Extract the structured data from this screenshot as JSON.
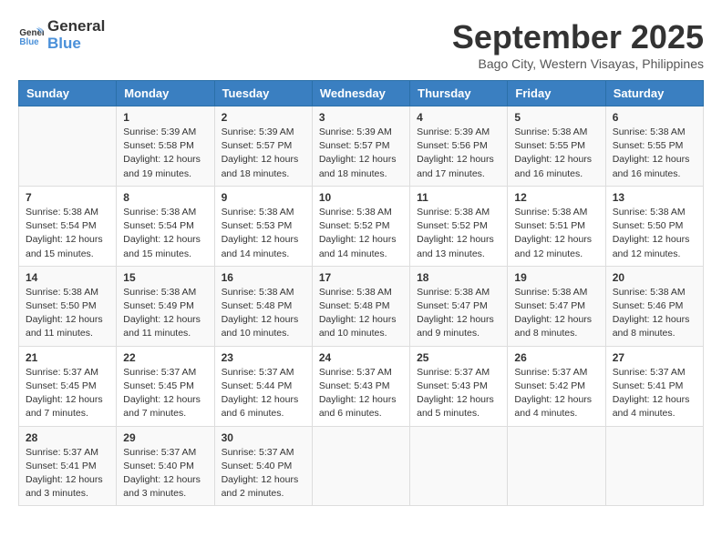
{
  "logo": {
    "text_general": "General",
    "text_blue": "Blue"
  },
  "title": {
    "month": "September 2025",
    "location": "Bago City, Western Visayas, Philippines"
  },
  "calendar": {
    "headers": [
      "Sunday",
      "Monday",
      "Tuesday",
      "Wednesday",
      "Thursday",
      "Friday",
      "Saturday"
    ],
    "weeks": [
      [
        {
          "day": "",
          "info": ""
        },
        {
          "day": "1",
          "info": "Sunrise: 5:39 AM\nSunset: 5:58 PM\nDaylight: 12 hours\nand 19 minutes."
        },
        {
          "day": "2",
          "info": "Sunrise: 5:39 AM\nSunset: 5:57 PM\nDaylight: 12 hours\nand 18 minutes."
        },
        {
          "day": "3",
          "info": "Sunrise: 5:39 AM\nSunset: 5:57 PM\nDaylight: 12 hours\nand 18 minutes."
        },
        {
          "day": "4",
          "info": "Sunrise: 5:39 AM\nSunset: 5:56 PM\nDaylight: 12 hours\nand 17 minutes."
        },
        {
          "day": "5",
          "info": "Sunrise: 5:38 AM\nSunset: 5:55 PM\nDaylight: 12 hours\nand 16 minutes."
        },
        {
          "day": "6",
          "info": "Sunrise: 5:38 AM\nSunset: 5:55 PM\nDaylight: 12 hours\nand 16 minutes."
        }
      ],
      [
        {
          "day": "7",
          "info": "Sunrise: 5:38 AM\nSunset: 5:54 PM\nDaylight: 12 hours\nand 15 minutes."
        },
        {
          "day": "8",
          "info": "Sunrise: 5:38 AM\nSunset: 5:54 PM\nDaylight: 12 hours\nand 15 minutes."
        },
        {
          "day": "9",
          "info": "Sunrise: 5:38 AM\nSunset: 5:53 PM\nDaylight: 12 hours\nand 14 minutes."
        },
        {
          "day": "10",
          "info": "Sunrise: 5:38 AM\nSunset: 5:52 PM\nDaylight: 12 hours\nand 14 minutes."
        },
        {
          "day": "11",
          "info": "Sunrise: 5:38 AM\nSunset: 5:52 PM\nDaylight: 12 hours\nand 13 minutes."
        },
        {
          "day": "12",
          "info": "Sunrise: 5:38 AM\nSunset: 5:51 PM\nDaylight: 12 hours\nand 12 minutes."
        },
        {
          "day": "13",
          "info": "Sunrise: 5:38 AM\nSunset: 5:50 PM\nDaylight: 12 hours\nand 12 minutes."
        }
      ],
      [
        {
          "day": "14",
          "info": "Sunrise: 5:38 AM\nSunset: 5:50 PM\nDaylight: 12 hours\nand 11 minutes."
        },
        {
          "day": "15",
          "info": "Sunrise: 5:38 AM\nSunset: 5:49 PM\nDaylight: 12 hours\nand 11 minutes."
        },
        {
          "day": "16",
          "info": "Sunrise: 5:38 AM\nSunset: 5:48 PM\nDaylight: 12 hours\nand 10 minutes."
        },
        {
          "day": "17",
          "info": "Sunrise: 5:38 AM\nSunset: 5:48 PM\nDaylight: 12 hours\nand 10 minutes."
        },
        {
          "day": "18",
          "info": "Sunrise: 5:38 AM\nSunset: 5:47 PM\nDaylight: 12 hours\nand 9 minutes."
        },
        {
          "day": "19",
          "info": "Sunrise: 5:38 AM\nSunset: 5:47 PM\nDaylight: 12 hours\nand 8 minutes."
        },
        {
          "day": "20",
          "info": "Sunrise: 5:38 AM\nSunset: 5:46 PM\nDaylight: 12 hours\nand 8 minutes."
        }
      ],
      [
        {
          "day": "21",
          "info": "Sunrise: 5:37 AM\nSunset: 5:45 PM\nDaylight: 12 hours\nand 7 minutes."
        },
        {
          "day": "22",
          "info": "Sunrise: 5:37 AM\nSunset: 5:45 PM\nDaylight: 12 hours\nand 7 minutes."
        },
        {
          "day": "23",
          "info": "Sunrise: 5:37 AM\nSunset: 5:44 PM\nDaylight: 12 hours\nand 6 minutes."
        },
        {
          "day": "24",
          "info": "Sunrise: 5:37 AM\nSunset: 5:43 PM\nDaylight: 12 hours\nand 6 minutes."
        },
        {
          "day": "25",
          "info": "Sunrise: 5:37 AM\nSunset: 5:43 PM\nDaylight: 12 hours\nand 5 minutes."
        },
        {
          "day": "26",
          "info": "Sunrise: 5:37 AM\nSunset: 5:42 PM\nDaylight: 12 hours\nand 4 minutes."
        },
        {
          "day": "27",
          "info": "Sunrise: 5:37 AM\nSunset: 5:41 PM\nDaylight: 12 hours\nand 4 minutes."
        }
      ],
      [
        {
          "day": "28",
          "info": "Sunrise: 5:37 AM\nSunset: 5:41 PM\nDaylight: 12 hours\nand 3 minutes."
        },
        {
          "day": "29",
          "info": "Sunrise: 5:37 AM\nSunset: 5:40 PM\nDaylight: 12 hours\nand 3 minutes."
        },
        {
          "day": "30",
          "info": "Sunrise: 5:37 AM\nSunset: 5:40 PM\nDaylight: 12 hours\nand 2 minutes."
        },
        {
          "day": "",
          "info": ""
        },
        {
          "day": "",
          "info": ""
        },
        {
          "day": "",
          "info": ""
        },
        {
          "day": "",
          "info": ""
        }
      ]
    ]
  }
}
